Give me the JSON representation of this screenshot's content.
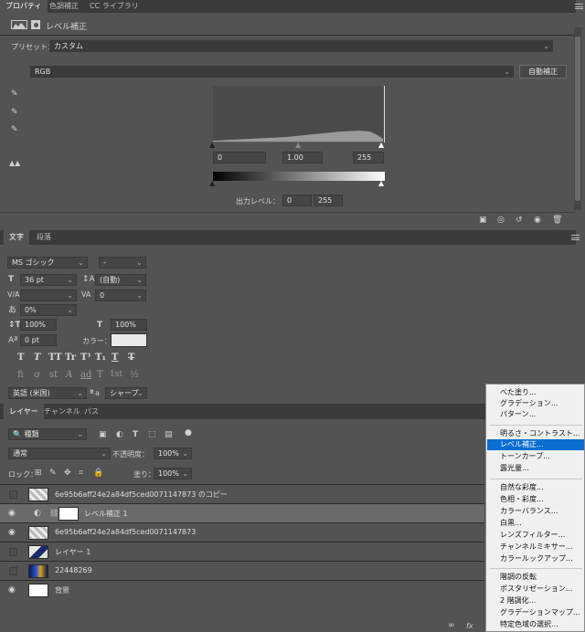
{
  "properties_panel": {
    "tabs": [
      "プロパティ",
      "色調補正",
      "CC ライブラリ"
    ],
    "title": "レベル補正",
    "preset_label": "プリセット：",
    "preset_value": "カスタム",
    "channel_value": "RGB",
    "auto_button": "自動補正",
    "input_levels": [
      "0",
      "1.00",
      "255"
    ],
    "output_label": "出力レベル：",
    "output_levels": [
      "0",
      "255"
    ]
  },
  "type_panel": {
    "tabs": [
      "文字",
      "段落"
    ],
    "font_family": "MS ゴシック",
    "font_style": "-",
    "font_size": "36 pt",
    "leading": "(自動)",
    "kerning": "",
    "tracking": "0",
    "tsume": "0%",
    "vertical_scale": "100%",
    "horizontal_scale": "100%",
    "baseline_shift": "0 pt",
    "color_label": "カラー：",
    "type_buttons": [
      "T",
      "T",
      "TT",
      "Tr",
      "T¹",
      "T₁",
      "T",
      "T"
    ],
    "opentype_buttons": [
      "fi",
      "ơ",
      "st",
      "A",
      "ad",
      "T",
      "1st",
      "½"
    ],
    "language": "英語 (米国)",
    "aa_label": "a",
    "antialias": "シャープ"
  },
  "layers_panel": {
    "tabs": [
      "レイヤー",
      "チャンネル",
      "パス"
    ],
    "filter_kind": "種類",
    "blend_mode": "通常",
    "opacity_label": "不透明度：",
    "opacity": "100%",
    "lock_label": "ロック：",
    "fill_label": "塗り：",
    "fill": "100%",
    "layers": [
      {
        "name": "6e95b6aff24e2a84df5ced0071147873 のコピー",
        "visible": false
      },
      {
        "name": "レベル補正 1",
        "visible": true,
        "selected": true
      },
      {
        "name": "6e95b6aff24e2a84df5ced0071147873",
        "visible": true
      },
      {
        "name": "レイヤー 1",
        "visible": false
      },
      {
        "name": "22448269",
        "visible": false
      },
      {
        "name": "背景",
        "visible": true
      }
    ],
    "footer_fx": "fx"
  },
  "adjustment_menu": {
    "items": [
      "べた塗り...",
      "グラデーション...",
      "パターン...",
      "明るさ・コントラスト...",
      "レベル補正...",
      "トーンカーブ...",
      "露光量...",
      "自然な彩度...",
      "色相・彩度...",
      "カラーバランス...",
      "白黒...",
      "レンズフィルター...",
      "チャンネルミキサー...",
      "カラールックアップ...",
      "階調の反転",
      "ポスタリゼーション...",
      "2 階調化...",
      "グラデーションマップ...",
      "特定色域の選択..."
    ],
    "highlighted": "レベル補正..."
  },
  "colors": {
    "panel": "#535353",
    "tab_bar": "#3b3b3b",
    "highlight": "#0a6ed1",
    "menu_bg": "#f0f0f0"
  }
}
